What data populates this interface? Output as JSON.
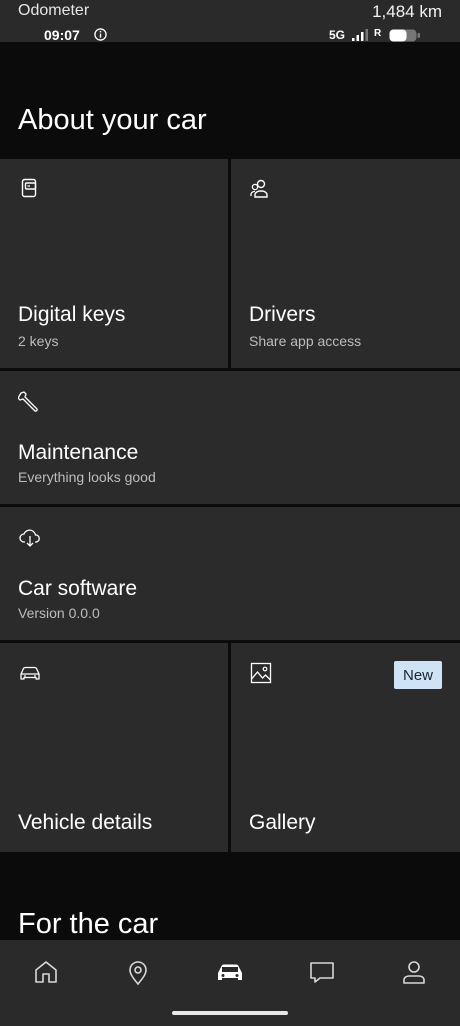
{
  "status_bar": {
    "odometer_label": "Odometer",
    "odometer_value": "1,484 km",
    "time": "09:07",
    "network": "5G",
    "roaming": "R"
  },
  "page": {
    "title": "About your car"
  },
  "tiles": {
    "digital_keys": {
      "title": "Digital keys",
      "subtitle": "2 keys",
      "icon": "key-card-icon"
    },
    "drivers": {
      "title": "Drivers",
      "subtitle": "Share app access",
      "icon": "users-icon"
    },
    "maintenance": {
      "title": "Maintenance",
      "subtitle": "Everything looks good",
      "icon": "wrench-icon"
    },
    "car_software": {
      "title": "Car software",
      "subtitle": "Version 0.0.0",
      "icon": "cloud-download-icon"
    },
    "vehicle_details": {
      "title": "Vehicle details",
      "icon": "car-icon"
    },
    "gallery": {
      "title": "Gallery",
      "badge": "New",
      "icon": "image-icon"
    }
  },
  "section": {
    "title": "For the car"
  },
  "bottom_nav": {
    "items": [
      "home-icon",
      "map-pin-icon",
      "car-icon",
      "chat-icon",
      "profile-icon"
    ],
    "active": "car-icon"
  },
  "colors": {
    "background": "#0b0b0b",
    "tile": "#2b2b2b",
    "badge": "#cfe3f7"
  }
}
